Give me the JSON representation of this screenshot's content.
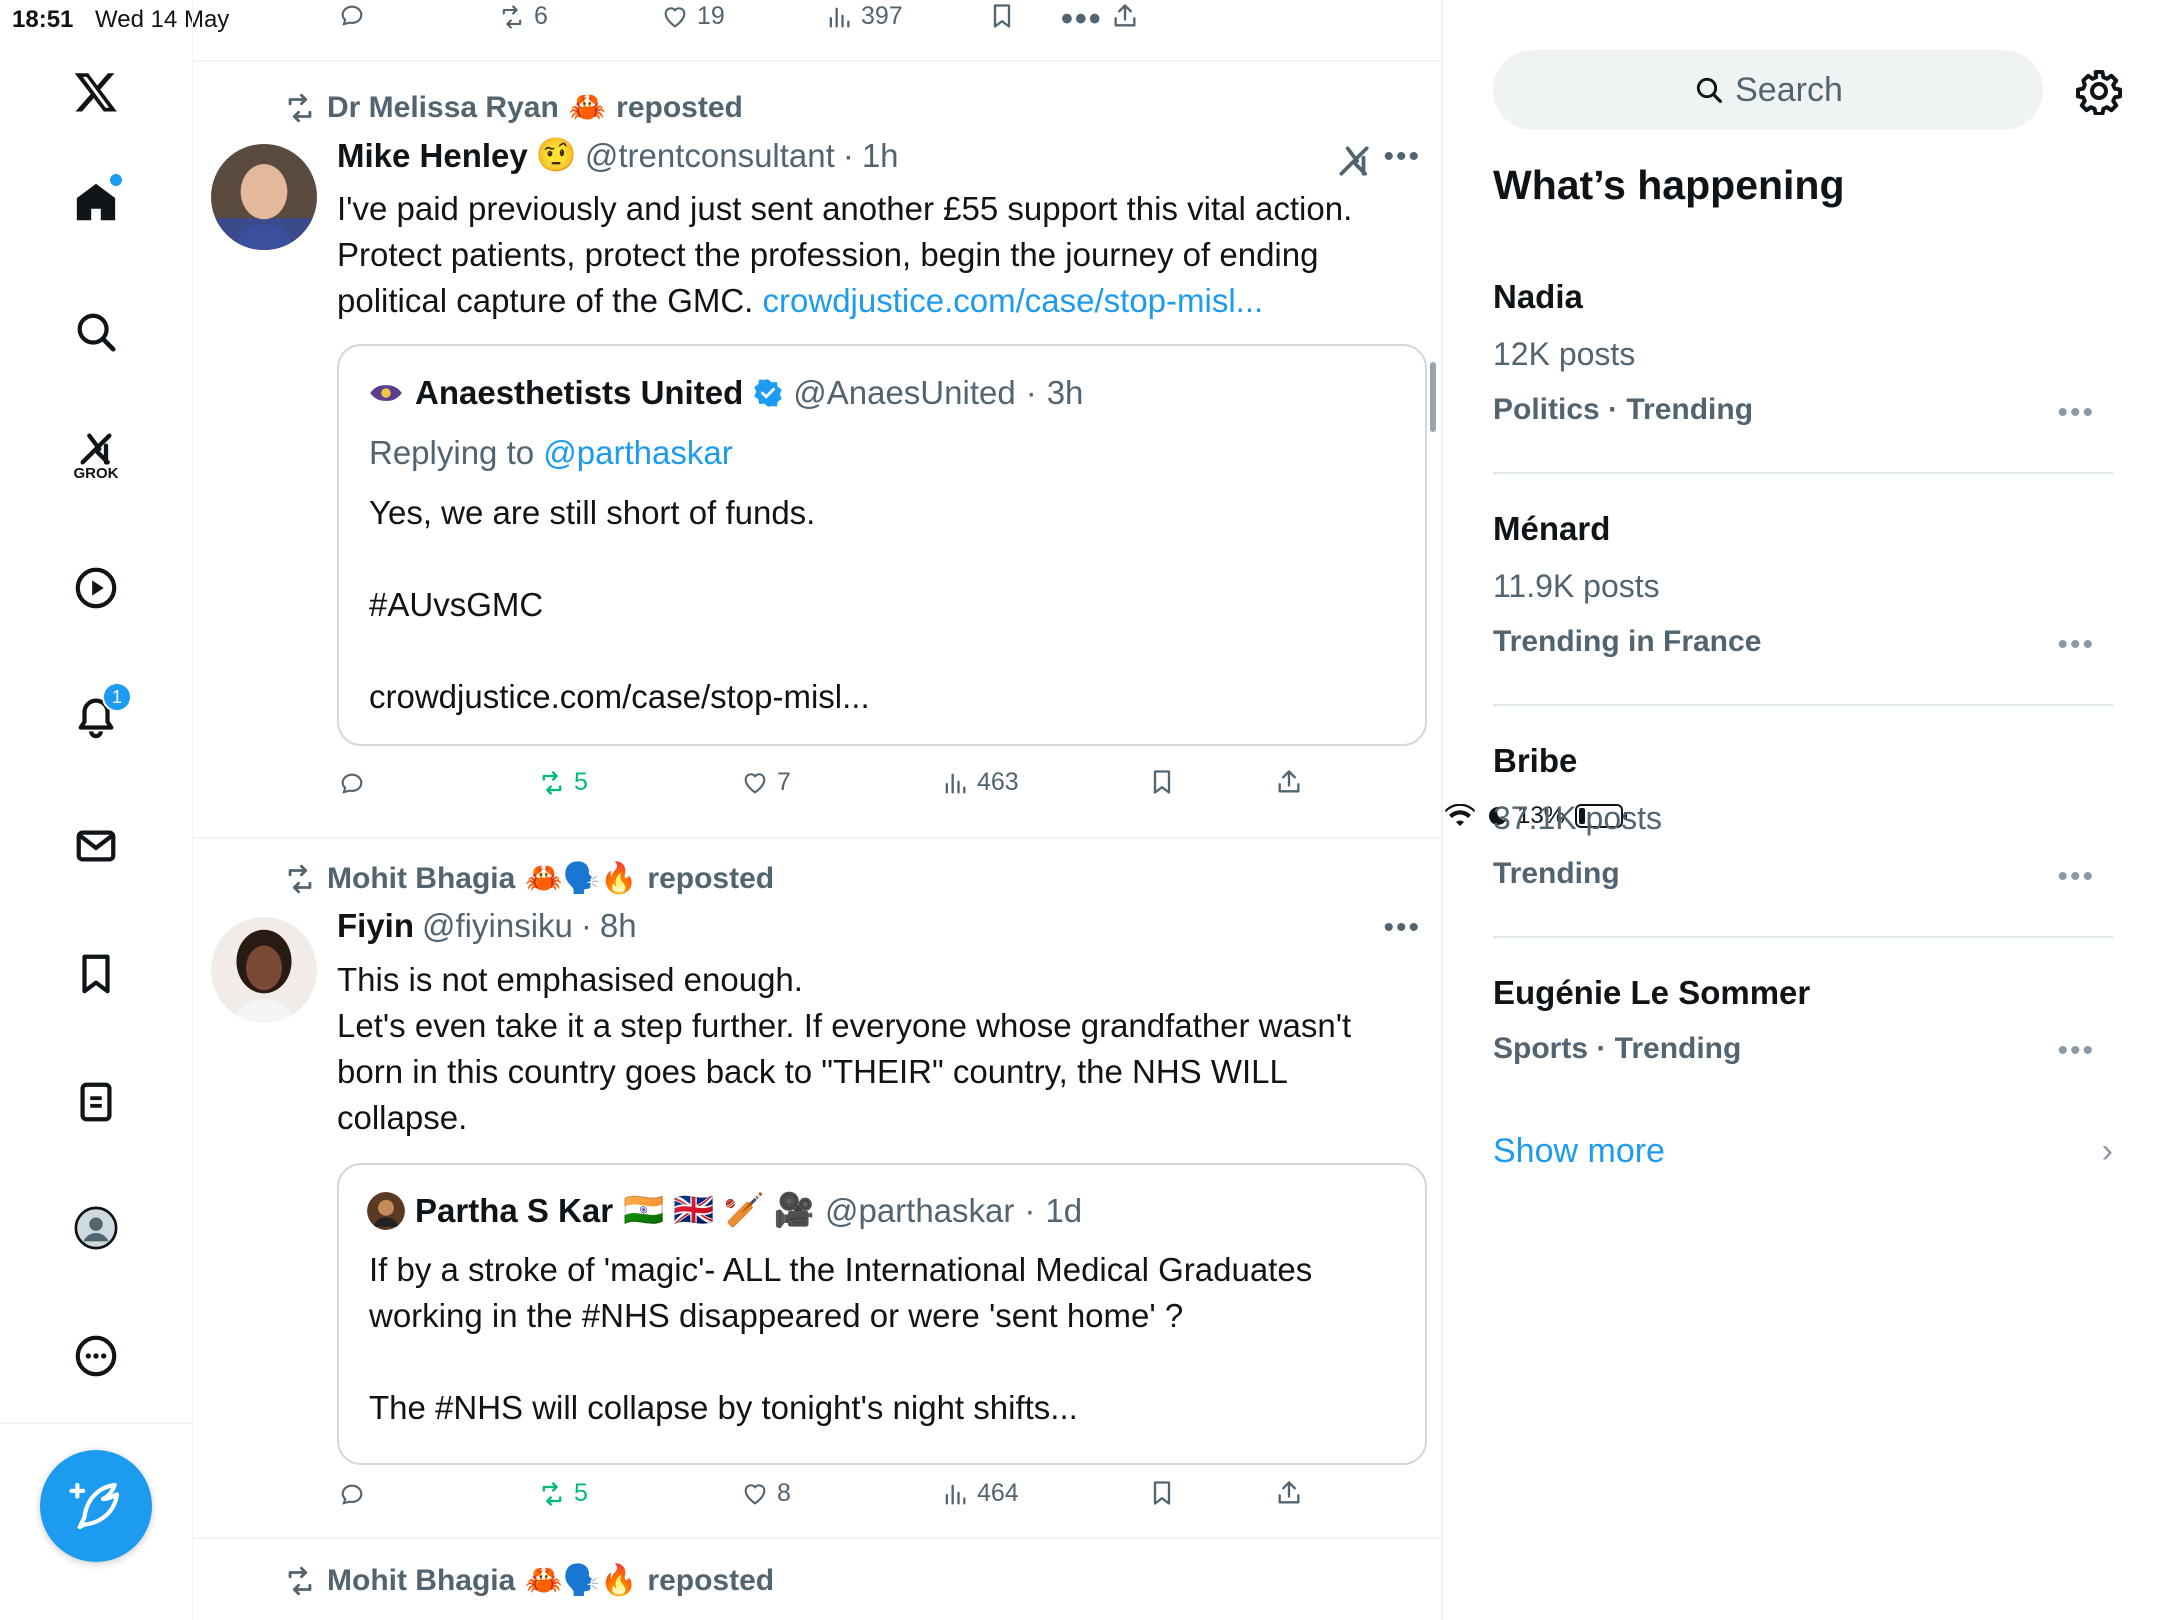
{
  "status_bar": {
    "time": "18:51",
    "date": "Wed 14 May",
    "battery": "13%"
  },
  "top_actions": {
    "retweets": "6",
    "likes": "19",
    "views": "397"
  },
  "tweets": [
    {
      "repost_by": "Dr Melissa Ryan",
      "repost_emoji": "🦀",
      "repost_label": "reposted",
      "name": "Mike Henley",
      "name_emoji": "🤨",
      "handle": "@trentconsultant",
      "time": "1h",
      "text_lines": [
        "I've paid previously and just sent another £55 support this vital action.",
        "Protect patients, protect the profession, begin the journey of ending",
        "political capture of the GMC. "
      ],
      "link": "crowdjustice.com/case/stop-misl...",
      "quote": {
        "name": "Anaesthetists United",
        "handle": "@AnaesUnited",
        "time": "3h",
        "replying_to_label": "Replying to",
        "replying_to_handle": "@parthaskar",
        "text": "Yes, we are still short of funds.\n\n#AUvsGMC\n\ncrowdjustice.com/case/stop-misl..."
      },
      "actions": {
        "retweets": "5",
        "likes": "7",
        "views": "463"
      }
    },
    {
      "repost_by": "Mohit Bhagia",
      "repost_emoji": "🦀🗣️🔥",
      "repost_label": "reposted",
      "name": "Fiyin",
      "handle": "@fiyinsiku",
      "time": "8h",
      "text": "This is not emphasised enough.\nLet's even take it a step further. If everyone whose grandfather wasn't\nborn in this country goes  back to \"THEIR\" country, the NHS WILL\ncollapse.",
      "quote": {
        "name": "Partha S Kar",
        "name_emoji": "🇮🇳 🇬🇧 🏏 🎥",
        "handle": "@parthaskar",
        "time": "1d",
        "text": "If by a stroke of 'magic'- ALL the International Medical Graduates\nworking in the #NHS disappeared or were 'sent home' ?\n\nThe #NHS will collapse by tonight's night shifts..."
      },
      "actions": {
        "retweets": "5",
        "likes": "8",
        "views": "464"
      }
    },
    {
      "repost_by": "Mohit Bhagia",
      "repost_emoji": "🦀🗣️🔥",
      "repost_label": "reposted"
    }
  ],
  "nav": {
    "grok_label": "GROK",
    "notifications_badge": "1"
  },
  "sidebar": {
    "search_placeholder": "Search",
    "heading": "What’s happening",
    "trends": [
      {
        "name": "Nadia",
        "count": "12K posts",
        "meta": "Politics · Trending"
      },
      {
        "name": "Ménard",
        "count": "11.9K posts",
        "meta": "Trending in France"
      },
      {
        "name": "Bribe",
        "count": "37.1K posts",
        "meta": "Trending"
      },
      {
        "name": "Eugénie Le Sommer",
        "meta": "Sports · Trending"
      }
    ],
    "show_more": "Show more"
  },
  "colors": {
    "accent": "#1d9bf0",
    "retweet_green": "#00ba7c",
    "muted": "#536471"
  }
}
